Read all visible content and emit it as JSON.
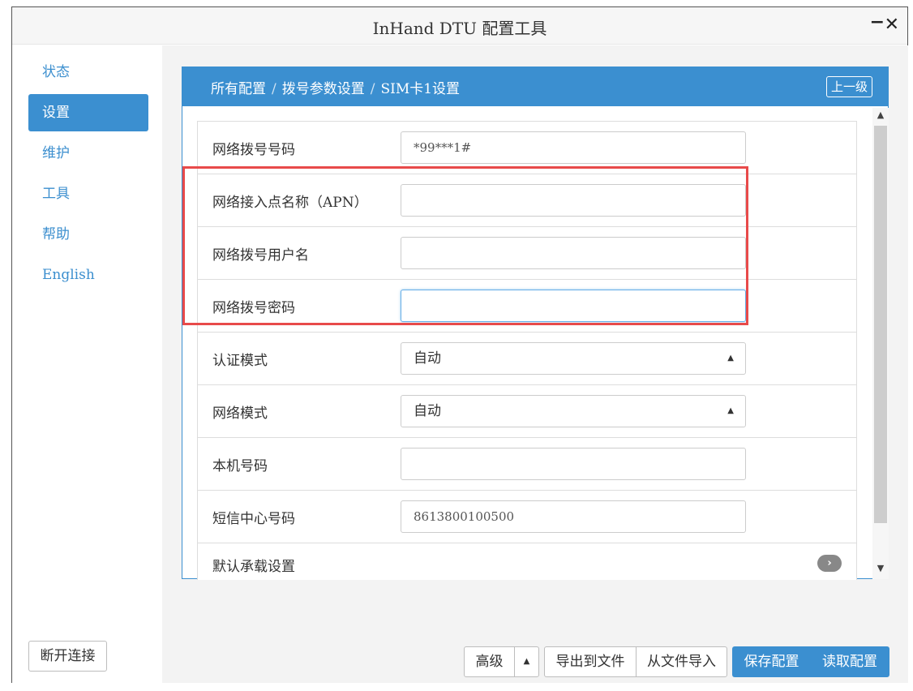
{
  "window": {
    "title": "InHand DTU 配置工具",
    "minimize": "−",
    "close": "✕"
  },
  "sidebar": {
    "items": [
      {
        "label": "状态"
      },
      {
        "label": "设置",
        "active": true
      },
      {
        "label": "维护"
      },
      {
        "label": "工具"
      },
      {
        "label": "帮助"
      },
      {
        "label": "English"
      }
    ],
    "disconnect": "断开连接"
  },
  "panel": {
    "breadcrumb": [
      "所有配置",
      "拨号参数设置",
      "SIM卡1设置"
    ],
    "breadcrumb_sep": "/",
    "up_button": "上一级",
    "rows": [
      {
        "label": "网络拨号号码",
        "value": "*99***1#"
      },
      {
        "label": "网络接入点名称（APN）",
        "value": ""
      },
      {
        "label": "网络拨号用户名",
        "value": ""
      },
      {
        "label": "网络拨号密码",
        "value": ""
      },
      {
        "label": "认证模式",
        "value": "自动"
      },
      {
        "label": "网络模式",
        "value": "自动"
      },
      {
        "label": "本机号码",
        "value": ""
      },
      {
        "label": "短信中心号码",
        "value": "8613800100500"
      },
      {
        "label": "默认承载设置"
      }
    ],
    "select_caret": "▲",
    "chevron": "›"
  },
  "scrollbar": {
    "up": "▲",
    "down": "▼"
  },
  "footer": {
    "advanced": "高级",
    "advanced_caret": "▲",
    "export": "导出到文件",
    "import": "从文件导入",
    "save": "保存配置",
    "read": "读取配置"
  },
  "colors": {
    "accent": "#3b8fd0",
    "highlight": "#e84a4a"
  }
}
